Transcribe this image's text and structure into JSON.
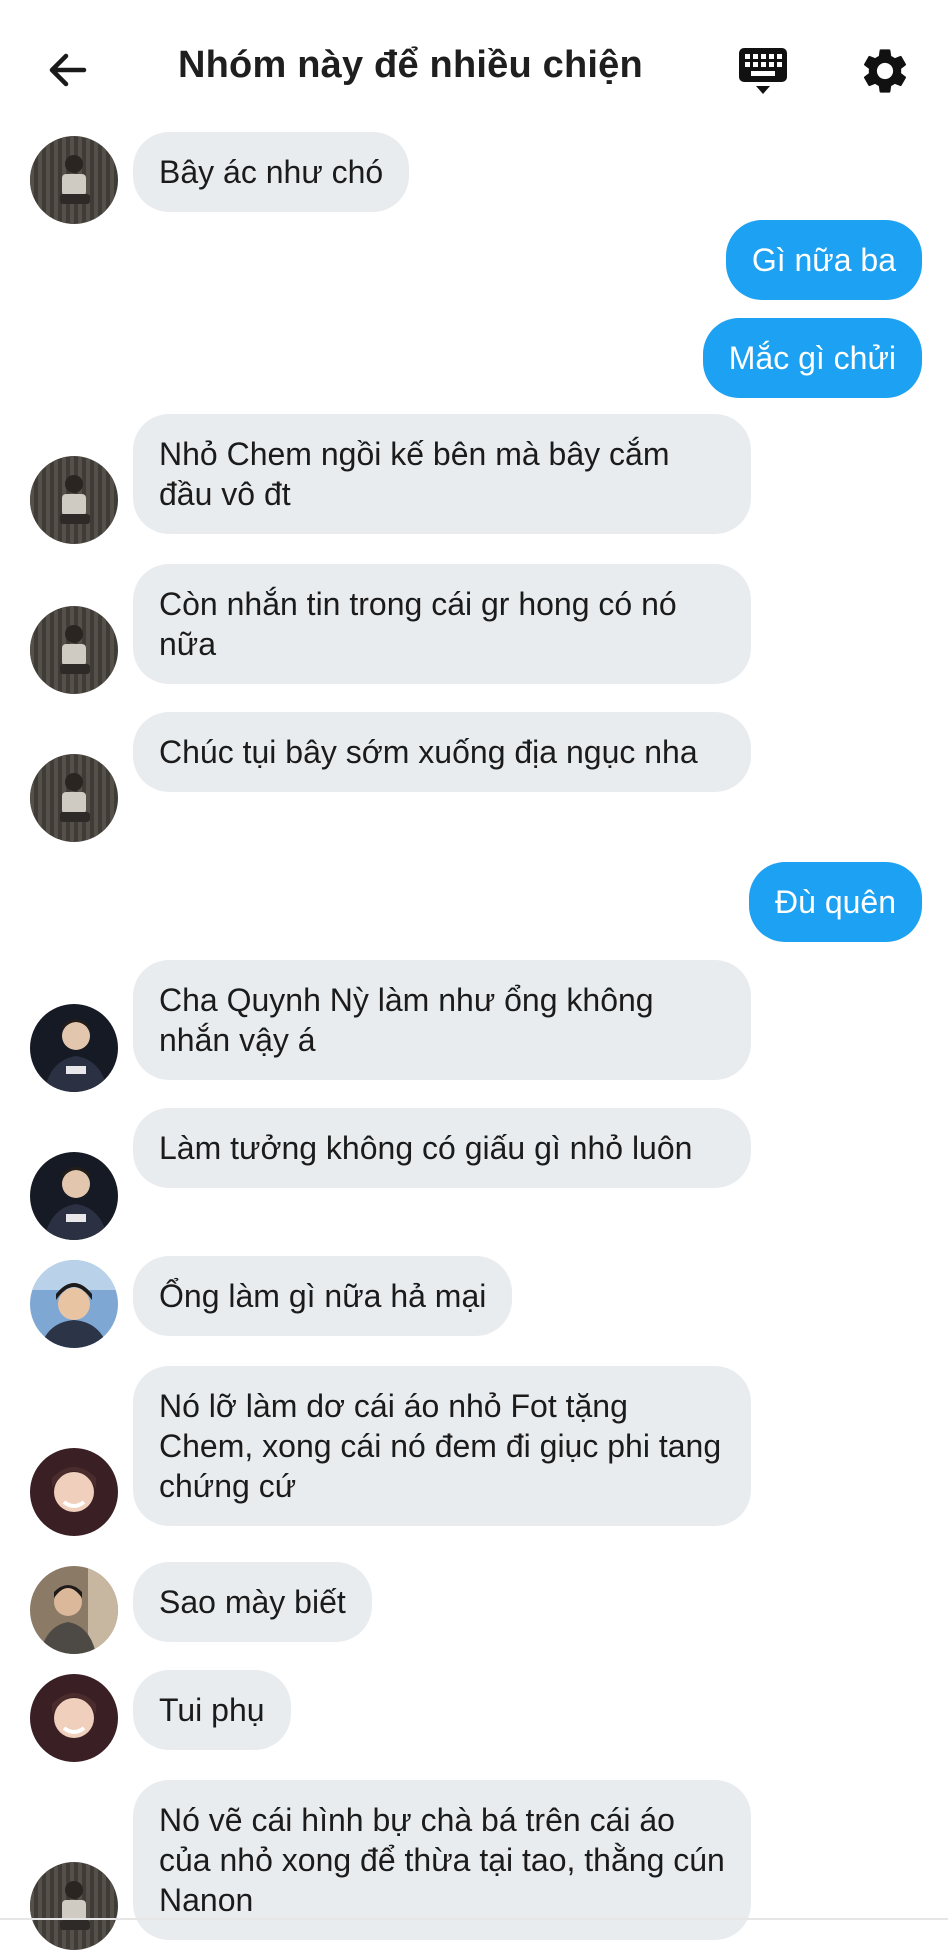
{
  "header": {
    "title": "Nhóm này để nhiều chiện",
    "back_icon": "arrow-left-icon",
    "keyboard_icon": "keyboard-icon",
    "settings_icon": "gear-icon"
  },
  "colors": {
    "accent": "#1da1f2",
    "incoming_bubble": "#e9ecef",
    "background": "#ffffff"
  },
  "messages": [
    {
      "side": "in",
      "avatar": "avatar-1",
      "text": "Bây ác như chó"
    },
    {
      "side": "out",
      "text": "Gì nữa ba"
    },
    {
      "side": "out",
      "text": "Mắc gì chửi"
    },
    {
      "side": "in",
      "avatar": "avatar-1",
      "text": "Nhỏ Chem ngồi kế bên mà bây cắm đầu vô đt"
    },
    {
      "side": "in",
      "avatar": "avatar-1",
      "text": "Còn nhắn tin trong cái gr hong có nó nữa"
    },
    {
      "side": "in",
      "avatar": "avatar-1",
      "text": "Chúc tụi bây sớm xuống địa ngục nha"
    },
    {
      "side": "out",
      "text": "Đù quên"
    },
    {
      "side": "in",
      "avatar": "avatar-2",
      "text": "Cha Quynh Nỳ làm như ổng không nhắn vậy á"
    },
    {
      "side": "in",
      "avatar": "avatar-2",
      "text": "Làm tưởng không có giấu gì nhỏ luôn"
    },
    {
      "side": "in",
      "avatar": "avatar-3",
      "text": "Ổng làm gì nữa hả mại"
    },
    {
      "side": "in",
      "avatar": "avatar-4",
      "text": "Nó lỡ làm dơ cái áo nhỏ Fot tặng Chem, xong cái nó đem đi giục phi tang chứng cứ"
    },
    {
      "side": "in",
      "avatar": "avatar-5",
      "text": "Sao mày biết"
    },
    {
      "side": "in",
      "avatar": "avatar-4",
      "text": "Tui phụ"
    },
    {
      "side": "in",
      "avatar": "avatar-1",
      "text": "Nó vẽ cái hình bự chà bá trên cái áo của nhỏ xong để thừa tại tao, thằng cún Nanon"
    }
  ]
}
